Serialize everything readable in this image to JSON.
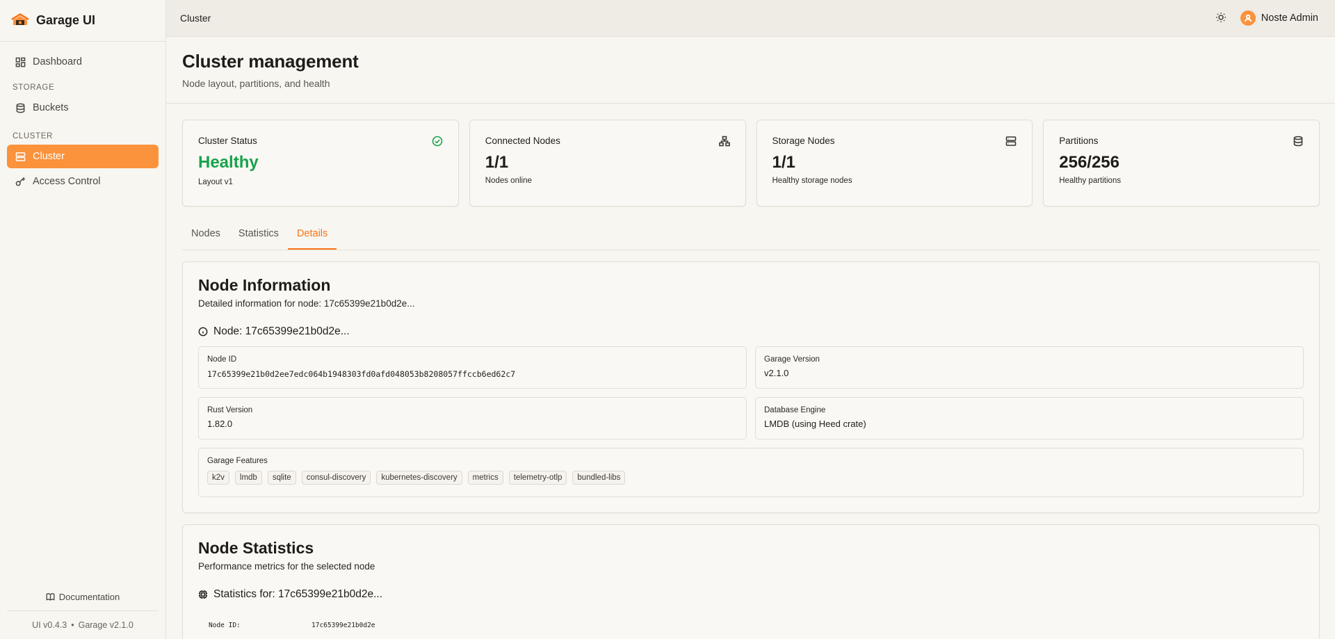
{
  "brand": {
    "name": "Garage UI"
  },
  "sidebar": {
    "dashboard": "Dashboard",
    "storage_section": "STORAGE",
    "buckets": "Buckets",
    "cluster_section": "CLUSTER",
    "cluster": "Cluster",
    "access_control": "Access Control",
    "documentation": "Documentation",
    "ui_version": "UI v0.4.3",
    "separator": "•",
    "garage_version": "Garage v2.1.0"
  },
  "topbar": {
    "title": "Cluster",
    "user": "Noste Admin"
  },
  "page": {
    "title": "Cluster management",
    "subtitle": "Node layout, partitions, and health"
  },
  "stats": [
    {
      "label": "Cluster Status",
      "value": "Healthy",
      "sub": "Layout v1",
      "icon": "check-circle-icon"
    },
    {
      "label": "Connected Nodes",
      "value": "1/1",
      "sub": "Nodes online",
      "icon": "network-icon"
    },
    {
      "label": "Storage Nodes",
      "value": "1/1",
      "sub": "Healthy storage nodes",
      "icon": "server-icon"
    },
    {
      "label": "Partitions",
      "value": "256/256",
      "sub": "Healthy partitions",
      "icon": "database-icon"
    }
  ],
  "tabs": [
    "Nodes",
    "Statistics",
    "Details"
  ],
  "active_tab": "Details",
  "node_info": {
    "title": "Node Information",
    "description": "Detailed information for node: 17c65399e21b0d2e...",
    "heading": "Node: 17c65399e21b0d2e...",
    "node_id_label": "Node ID",
    "node_id": "17c65399e21b0d2ee7edc064b1948303fd0afd048053b8208057ffccb6ed62c7",
    "garage_version_label": "Garage Version",
    "garage_version": "v2.1.0",
    "rust_version_label": "Rust Version",
    "rust_version": "1.82.0",
    "db_engine_label": "Database Engine",
    "db_engine": "LMDB (using Heed crate)",
    "features_label": "Garage Features",
    "features": [
      "k2v",
      "lmdb",
      "sqlite",
      "consul-discovery",
      "kubernetes-discovery",
      "metrics",
      "telemetry-otlp",
      "bundled-libs"
    ]
  },
  "node_stats": {
    "title": "Node Statistics",
    "description": "Performance metrics for the selected node",
    "heading": "Statistics for: 17c65399e21b0d2e...",
    "row_key": "Node ID:",
    "row_value": "17c65399e21b0d2e"
  }
}
